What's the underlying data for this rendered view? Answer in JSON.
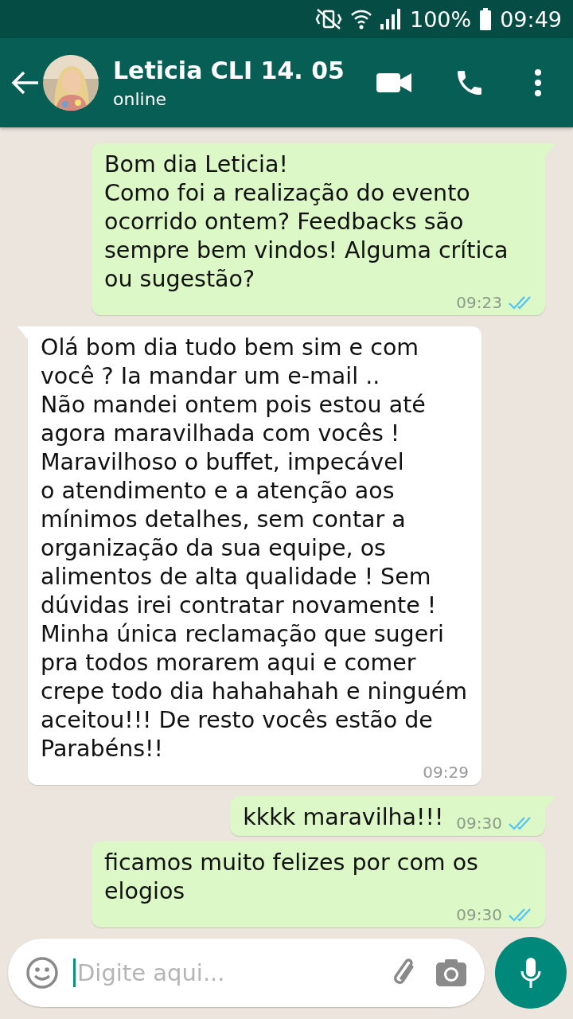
{
  "status_bar": {
    "battery": "100%",
    "time": "09:49"
  },
  "header": {
    "contact_name": "Leticia CLI 14. 05",
    "status": "online"
  },
  "messages": [
    {
      "kind": "outgoing",
      "text": "Bom dia Leticia!\nComo foi a realização do evento ocorrido ontem? Feedbacks são sempre bem vindos! Alguma crítica ou sugestão?",
      "time": "09:23",
      "read": true
    },
    {
      "kind": "incoming",
      "text": "Olá bom dia tudo bem sim e com você ? Ia mandar um e-mail ..\nNão mandei ontem pois estou até agora maravilhada com vocês !\nMaravilhoso o buffet, impecável\no atendimento e a atenção aos mínimos detalhes, sem contar a organização da sua equipe, os alimentos de alta qualidade ! Sem dúvidas irei contratar novamente !\nMinha única reclamação que sugeri pra todos morarem aqui e comer crepe todo dia hahahahah e ninguém aceitou!!! De resto vocês estão de Parabéns!!",
      "time": "09:29"
    },
    {
      "kind": "outgoing",
      "text": "kkkk maravilha!!!",
      "time": "09:30",
      "read": true
    },
    {
      "kind": "outgoing",
      "text": "ficamos muito felizes por com os elogios",
      "time": "09:30",
      "read": true
    }
  ],
  "composer": {
    "placeholder": "Digite aqui..."
  }
}
